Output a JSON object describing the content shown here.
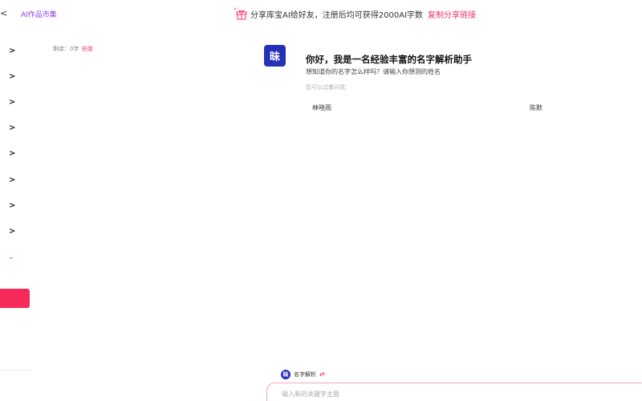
{
  "sidebar": {
    "market_label": "AI作品市集",
    "balance_label": "剩余：0字",
    "recharge_label": "充值",
    "menu_chevron": ">",
    "expand_chevron": "⌄"
  },
  "banner": {
    "text": "分享库宝AI给好友，注册后均可获得2000AI字数",
    "copy_link": "复制分享链接"
  },
  "chat": {
    "avatar_glyph": "昧",
    "greeting": "你好，我是一名经验丰富的名字解析助手",
    "subtext": "想知道你的名字怎么样吗？请输入你想测的姓名",
    "try_label": "您可以试着问我：",
    "suggestions": [
      "林晓雨",
      "陈默"
    ]
  },
  "composer": {
    "tool_name": "名字解析",
    "swap_icon": "⇄",
    "placeholder": "输入新的关键字主题"
  },
  "colors": {
    "accent": "#f0306a",
    "market": "#8b3cf0",
    "avatar_bg": "#2430b8",
    "red_block": "#f52a5b"
  }
}
